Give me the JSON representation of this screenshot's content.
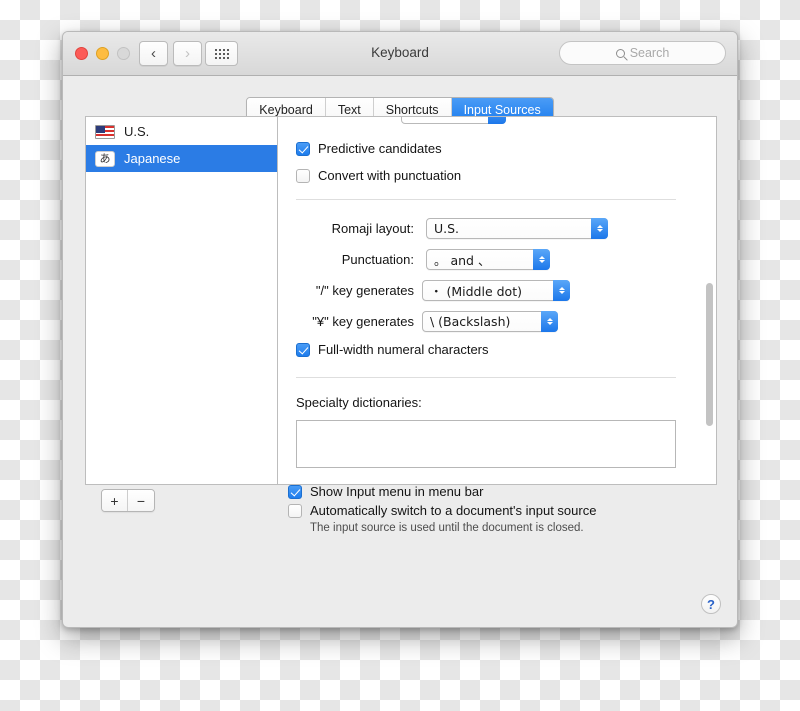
{
  "window": {
    "title": "Keyboard",
    "traffic_lights": [
      "close",
      "minimize",
      "zoom-disabled"
    ],
    "nav": {
      "back": "‹",
      "forward": "›",
      "grid": "grid-icon"
    },
    "search": {
      "placeholder": "Search",
      "value": ""
    }
  },
  "tabs": [
    {
      "label": "Keyboard",
      "active": false
    },
    {
      "label": "Text",
      "active": false
    },
    {
      "label": "Shortcuts",
      "active": false
    },
    {
      "label": "Input Sources",
      "active": true
    }
  ],
  "input_sources": [
    {
      "label": "U.S.",
      "icon": "us-flag-icon",
      "selected": false
    },
    {
      "label": "Japanese",
      "icon": "japanese-hiragana-icon",
      "glyph": "あ",
      "selected": true
    }
  ],
  "detail": {
    "checkboxes_top": [
      {
        "label": "Predictive candidates",
        "checked": true
      },
      {
        "label": "Convert with punctuation",
        "checked": false
      }
    ],
    "fields": [
      {
        "label": "Romaji layout:",
        "value": "U.S."
      },
      {
        "label": "Punctuation:",
        "value": "。 and 、"
      },
      {
        "label": "\"/\" key generates",
        "value": "・ (Middle dot)"
      },
      {
        "label": "\"¥\" key generates",
        "value": "\\ (Backslash)"
      }
    ],
    "checkbox_fullwidth": {
      "label": "Full-width numeral characters",
      "checked": true
    },
    "specialty_dictionaries_label": "Specialty dictionaries:",
    "specialty_dictionaries_items": []
  },
  "list_controls": {
    "add": "+",
    "remove": "−"
  },
  "bottom": {
    "show_input_menu": {
      "label": "Show Input menu in menu bar",
      "checked": true
    },
    "auto_switch": {
      "label": "Automatically switch to a document's input source",
      "checked": false
    },
    "help_text": "The input source is used until the document is closed."
  },
  "help_button": {
    "label": "?"
  },
  "colors": {
    "accent": "#1d7ced",
    "selection": "#2b7ce5",
    "window_bg": "#ececec"
  }
}
